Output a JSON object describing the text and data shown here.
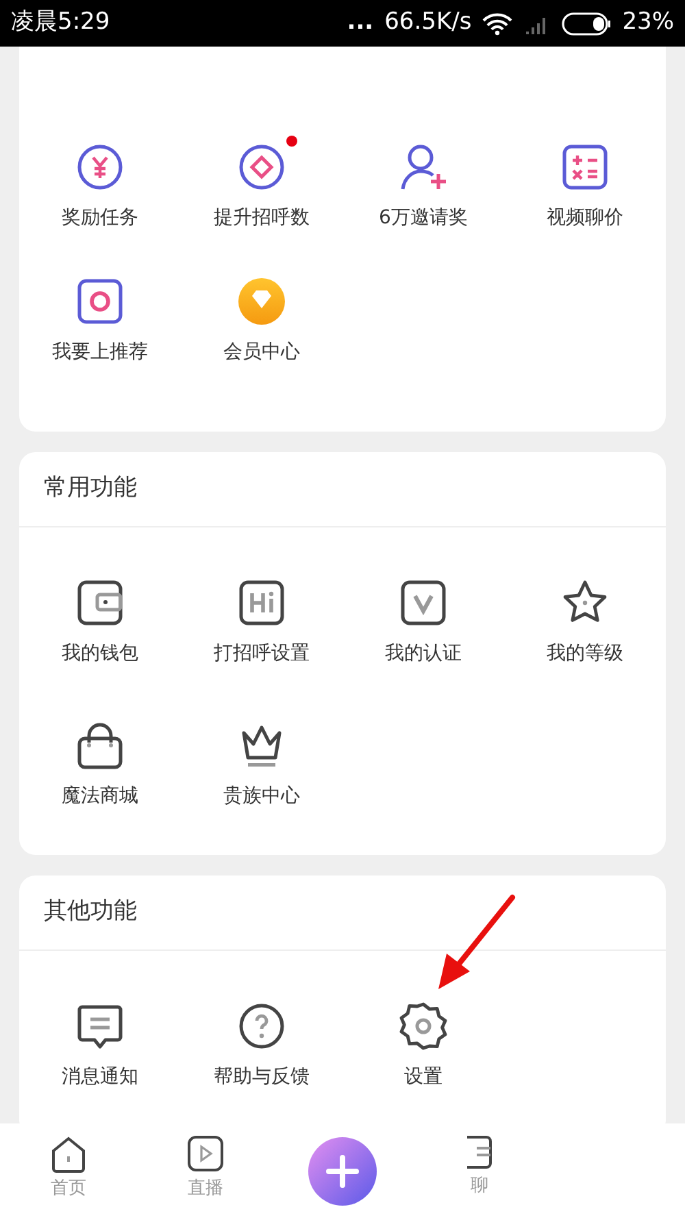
{
  "status_bar": {
    "time": "凌晨5:29",
    "dots": "...",
    "speed": "66.5K/s",
    "battery": "23%"
  },
  "sections": [
    {
      "items": [
        {
          "label": "奖励任务",
          "dot": false
        },
        {
          "label": "提升招呼数",
          "dot": true
        },
        {
          "label": "6万邀请奖",
          "dot": false
        },
        {
          "label": "视频聊价",
          "dot": false
        },
        {
          "label": "我要上推荐",
          "dot": false
        },
        {
          "label": "会员中心",
          "dot": false
        }
      ]
    },
    {
      "title": "常用功能",
      "items": [
        {
          "label": "我的钱包",
          "dot": false
        },
        {
          "label": "打招呼设置",
          "dot": false
        },
        {
          "label": "我的认证",
          "dot": false
        },
        {
          "label": "我的等级",
          "dot": false
        },
        {
          "label": "魔法商城",
          "dot": false
        },
        {
          "label": "贵族中心",
          "dot": false
        }
      ]
    },
    {
      "title": "其他功能",
      "items": [
        {
          "label": "消息通知",
          "dot": false
        },
        {
          "label": "帮助与反馈",
          "dot": false
        },
        {
          "label": "设置",
          "dot": false
        }
      ]
    }
  ],
  "bottom_nav": [
    {
      "kind": "tab",
      "label": "首页",
      "selected": false
    },
    {
      "kind": "tab",
      "label": "直播",
      "selected": false
    },
    {
      "kind": "plus"
    },
    {
      "kind": "tab",
      "label": "聊",
      "selected": false
    }
  ]
}
